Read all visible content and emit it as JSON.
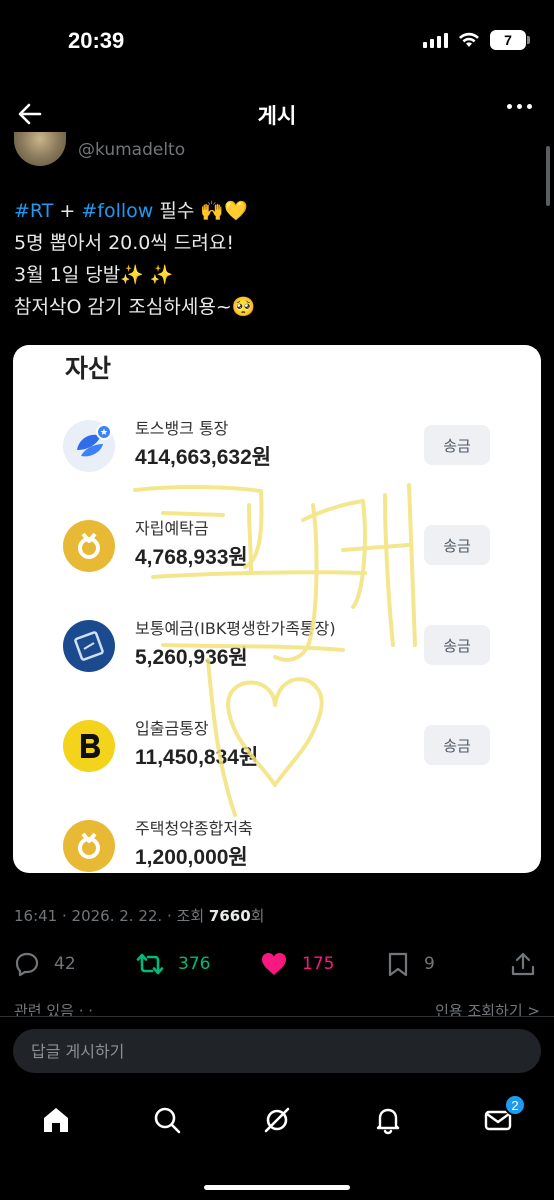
{
  "status_bar": {
    "time": "20:39",
    "battery": "7"
  },
  "header": {
    "title": "게시"
  },
  "author": {
    "handle": "@kumadelto"
  },
  "post": {
    "line1_tag1": "#RT",
    "line1_plus": " + ",
    "line1_tag2": "#follow",
    "line1_rest": " 필수 🙌💛",
    "line2": "5명 뽑아서 20.0씩 드려요!",
    "line3": "3월 1일 당발✨ ✨",
    "line4": "참저삭O 감기 조심하세용~🥺"
  },
  "card": {
    "title": "자산",
    "assets": [
      {
        "name": "토스뱅크 통장",
        "amount": "414,663,632원",
        "button": "송금",
        "icon": "toss-bank-icon"
      },
      {
        "name": "자립예탁금",
        "amount": "4,768,933원",
        "button": "송금",
        "icon": "gold-medal-icon"
      },
      {
        "name": "보통예금(IBK평생한가족통장)",
        "amount": "5,260,936원",
        "button": "송금",
        "icon": "ibk-icon"
      },
      {
        "name": "입출금통장",
        "amount": "11,450,834원",
        "button": "송금",
        "icon": "kbank-b-icon"
      },
      {
        "name": "주택청약종합저축",
        "amount": "1,200,000원",
        "icon": "gold-medal-icon"
      }
    ]
  },
  "meta": {
    "time": "16:41",
    "date": "2026. 2. 22.",
    "views_label": "조회",
    "views": "7660",
    "views_suffix": "회"
  },
  "actions": {
    "replies": "42",
    "retweets": "376",
    "likes": "175",
    "bookmarks": "9"
  },
  "related": {
    "left": "관련 있음 · ·",
    "right": "인용 조회하기 >"
  },
  "reply": {
    "placeholder": "답글 게시하기"
  },
  "nav": {
    "messages_badge": "2"
  },
  "colors": {
    "accent": "#1d9bf0",
    "retweet": "#00ba7c",
    "like": "#f91880"
  }
}
